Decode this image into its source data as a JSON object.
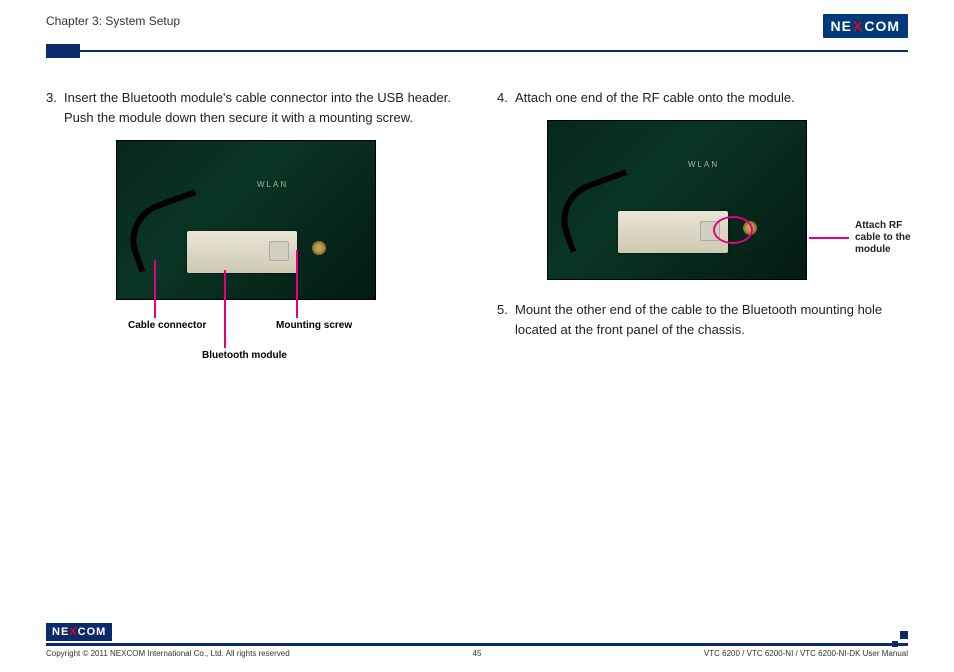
{
  "header": {
    "chapter": "Chapter 3: System Setup",
    "brand_pre": "NE",
    "brand_x": "X",
    "brand_post": "COM"
  },
  "left": {
    "step3_num": "3.",
    "step3_text": "Insert the Bluetooth module's cable connector into the USB header. Push the module down then secure it with a mounting screw.",
    "callout_cable": "Cable connector",
    "callout_bt": "Bluetooth module",
    "callout_screw": "Mounting screw"
  },
  "right": {
    "step4_num": "4.",
    "step4_text": "Attach one end of the RF cable onto the module.",
    "anno_rf": "Attach RF cable to the module",
    "step5_num": "5.",
    "step5_text": "Mount the other end of the cable to the Bluetooth mounting hole located at the front panel of the chassis."
  },
  "footer": {
    "copyright": "Copyright © 2011 NEXCOM International Co., Ltd. All rights reserved",
    "page": "45",
    "doc": "VTC 6200 / VTC 6200-NI / VTC 6200-NI-DK User Manual",
    "brand_pre": "NE",
    "brand_x": "X",
    "brand_post": "COM"
  }
}
